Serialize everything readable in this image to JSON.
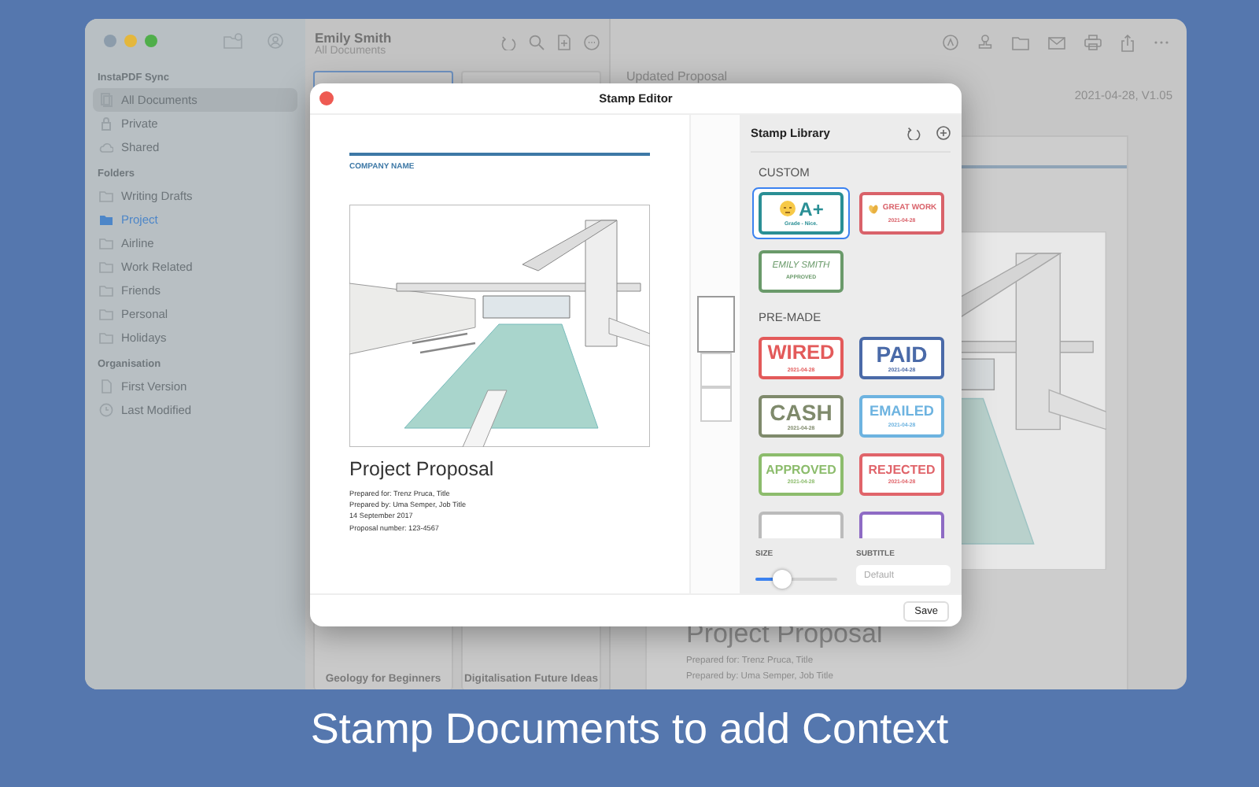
{
  "sidebar": {
    "sections": [
      {
        "title": "InstaPDF Sync",
        "items": [
          {
            "label": "All Documents",
            "kind": "docs",
            "selected": true,
            "current": false
          },
          {
            "label": "Private",
            "kind": "lock",
            "selected": false,
            "current": false
          },
          {
            "label": "Shared",
            "kind": "cloud",
            "selected": false,
            "current": false
          }
        ]
      },
      {
        "title": "Folders",
        "items": [
          {
            "label": "Writing Drafts",
            "kind": "folder",
            "selected": false,
            "current": false
          },
          {
            "label": "Project",
            "kind": "folder",
            "selected": false,
            "current": true
          },
          {
            "label": "Airline",
            "kind": "folder",
            "selected": false,
            "current": false
          },
          {
            "label": "Work Related",
            "kind": "folder",
            "selected": false,
            "current": false
          },
          {
            "label": "Friends",
            "kind": "folder",
            "selected": false,
            "current": false
          },
          {
            "label": "Personal",
            "kind": "folder",
            "selected": false,
            "current": false
          },
          {
            "label": "Holidays",
            "kind": "folder",
            "selected": false,
            "current": false
          }
        ]
      },
      {
        "title": "Organisation",
        "items": [
          {
            "label": "First Version",
            "kind": "file",
            "selected": false,
            "current": false
          },
          {
            "label": "Last Modified",
            "kind": "clock",
            "selected": false,
            "current": false
          }
        ]
      }
    ]
  },
  "document_list": {
    "title": "Emily Smith",
    "subtitle": "All Documents",
    "cards": [
      {
        "selected": true
      },
      {
        "selected": false
      },
      {
        "title": "Geology for Beginners",
        "selected": false
      },
      {
        "title": "Digitalisation Future Ideas",
        "selected": false
      }
    ]
  },
  "main": {
    "title": "Updated Proposal",
    "version": "2021-04-28, V1.05",
    "heading": "Project Proposal",
    "lines": [
      "Prepared for: Trenz Pruca, Title",
      "Prepared by: Uma Semper, Job Title"
    ]
  },
  "stamp_editor": {
    "title": "Stamp Editor",
    "page": {
      "company": "COMPANY NAME",
      "heading": "Project Proposal",
      "lines": [
        "Prepared for: Trenz Pruca, Title",
        "Prepared by: Uma Semper, Job Title",
        "14 September 2017",
        "Proposal number: 123-4567"
      ]
    },
    "thumbnails": [
      {
        "selected": true
      },
      {
        "selected": false
      },
      {
        "selected": false
      }
    ],
    "library": {
      "title": "Stamp Library",
      "sections": [
        {
          "title": "CUSTOM",
          "stamps": [
            {
              "text": "A+",
              "subtitle": "Grade - Nice.",
              "kind": "emoji-face",
              "color": "#2a8f95",
              "selected": true
            },
            {
              "text": "GREAT WORK",
              "subtitle": "2021-04-28",
              "kind": "emoji-clap",
              "color": "#d9626a",
              "selected": false
            },
            {
              "text": "EMILY SMITH",
              "subtitle": "APPROVED",
              "kind": "signature",
              "color": "#6a9a6a",
              "selected": false
            }
          ]
        },
        {
          "title": "PRE-MADE",
          "stamps": [
            {
              "text": "WIRED",
              "subtitle": "2021-04-28",
              "kind": "plain",
              "color": "#e35a5a",
              "selected": false
            },
            {
              "text": "PAID",
              "subtitle": "2021-04-28",
              "kind": "plain",
              "color": "#4a6aa8",
              "selected": false
            },
            {
              "text": "CASH",
              "subtitle": "2021-04-28",
              "kind": "plain",
              "color": "#7f8a6c",
              "selected": false
            },
            {
              "text": "EMAILED",
              "subtitle": "2021-04-28",
              "kind": "plain",
              "color": "#6db3e0",
              "selected": false
            },
            {
              "text": "APPROVED",
              "subtitle": "2021-04-28",
              "kind": "plain",
              "color": "#8cbc6c",
              "selected": false
            },
            {
              "text": "REJECTED",
              "subtitle": "2021-04-28",
              "kind": "plain",
              "color": "#e0646a",
              "selected": false
            },
            {
              "kind": "cut",
              "color": "#bbbbbb",
              "selected": false
            },
            {
              "kind": "cut",
              "color": "#8e6bc4",
              "selected": false
            }
          ]
        }
      ]
    },
    "size": {
      "label": "SIZE",
      "level": 0.33
    },
    "subtitle": {
      "label": "SUBTITLE",
      "placeholder": "Default"
    },
    "save": "Save"
  },
  "caption": "Stamp Documents to add Context"
}
